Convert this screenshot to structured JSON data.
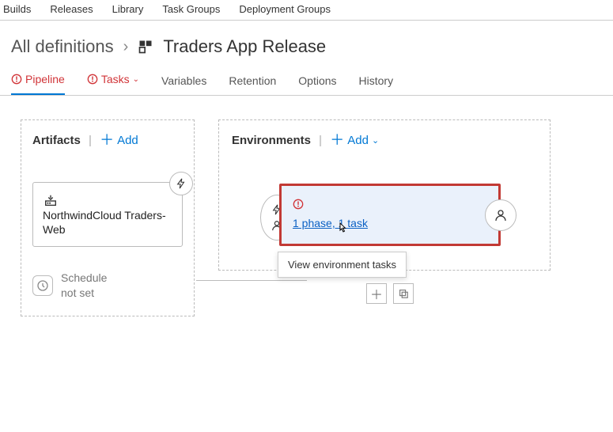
{
  "topnav": [
    "Builds",
    "Releases",
    "Library",
    "Task Groups",
    "Deployment Groups"
  ],
  "breadcrumb": {
    "all": "All definitions",
    "title": "Traders App Release"
  },
  "tabs": {
    "pipeline": "Pipeline",
    "tasks": "Tasks",
    "variables": "Variables",
    "retention": "Retention",
    "options": "Options",
    "history": "History"
  },
  "artifacts": {
    "title": "Artifacts",
    "add": "Add",
    "card_name": "NorthwindCloud Traders-Web",
    "schedule": "Schedule not set"
  },
  "environments": {
    "title": "Environments",
    "add": "Add",
    "phase_link": "1 phase, 1 task",
    "tooltip": "View environment tasks"
  }
}
